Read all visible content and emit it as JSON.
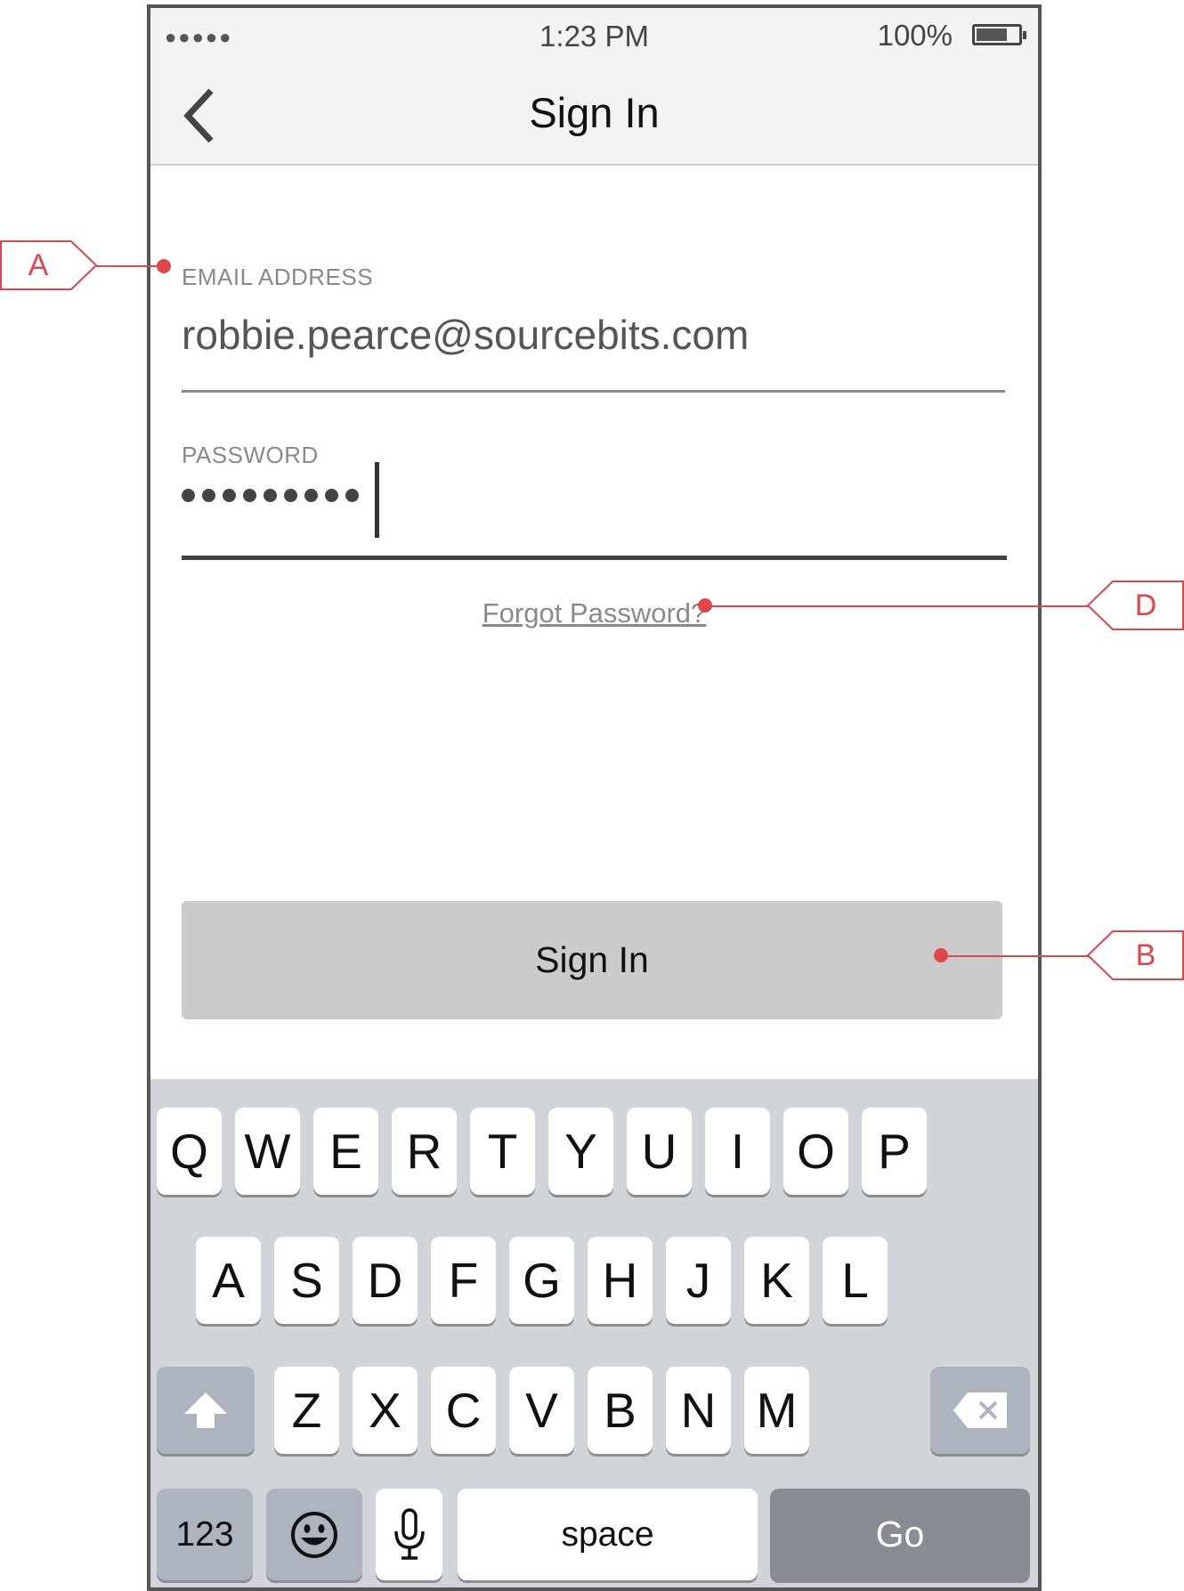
{
  "status_bar": {
    "signal": "●●●●●",
    "time": "1:23 PM",
    "battery": "100%"
  },
  "header": {
    "title": "Sign In"
  },
  "form": {
    "email_label": "EMAIL ADDRESS",
    "email_value": "robbie.pearce@sourcebits.com",
    "password_label": "PASSWORD",
    "password_dot_count": 9,
    "forgot_link": "Forgot Password?",
    "submit_label": "Sign In"
  },
  "keyboard": {
    "row1": [
      "Q",
      "W",
      "E",
      "R",
      "T",
      "Y",
      "U",
      "I",
      "O",
      "P"
    ],
    "row2": [
      "A",
      "S",
      "D",
      "F",
      "G",
      "H",
      "J",
      "K",
      "L"
    ],
    "row3": [
      "Z",
      "X",
      "C",
      "V",
      "B",
      "N",
      "M"
    ],
    "numbers_key": "123",
    "space_key": "space",
    "go_key": "Go"
  },
  "annotations": {
    "a": "A",
    "b": "B",
    "d": "D"
  },
  "colors": {
    "annotation": "#e0464b",
    "button": "#cbcbcb",
    "keyboard_bg": "#d1d5da"
  }
}
